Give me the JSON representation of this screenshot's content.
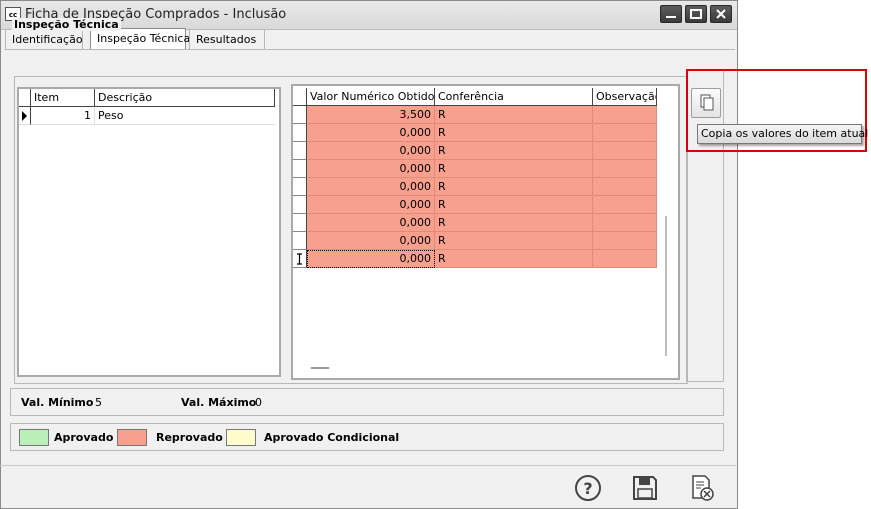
{
  "window": {
    "title": "Ficha de Inspeção Comprados - Inclusão",
    "app_icon_text": "cc"
  },
  "tabs": [
    {
      "label": "Identificação",
      "active": false
    },
    {
      "label": "Inspeção Técnica",
      "active": true
    },
    {
      "label": "Resultados",
      "active": false
    }
  ],
  "group": {
    "title": "Inspeção Técnica"
  },
  "items_grid": {
    "columns": [
      "Item",
      "Descrição"
    ],
    "rows": [
      {
        "item": "1",
        "descricao": "Peso"
      }
    ]
  },
  "values_grid": {
    "columns": [
      "Valor Numérico Obtido",
      "Conferência",
      "Observação"
    ],
    "rows": [
      {
        "valor": "3,500",
        "conferencia": "R",
        "observacao": ""
      },
      {
        "valor": "0,000",
        "conferencia": "R",
        "observacao": ""
      },
      {
        "valor": "0,000",
        "conferencia": "R",
        "observacao": ""
      },
      {
        "valor": "0,000",
        "conferencia": "R",
        "observacao": ""
      },
      {
        "valor": "0,000",
        "conferencia": "R",
        "observacao": ""
      },
      {
        "valor": "0,000",
        "conferencia": "R",
        "observacao": ""
      },
      {
        "valor": "0,000",
        "conferencia": "R",
        "observacao": ""
      },
      {
        "valor": "0,000",
        "conferencia": "R",
        "observacao": ""
      },
      {
        "valor": "0,000",
        "conferencia": "R",
        "observacao": ""
      }
    ],
    "row_color": "#f7a08d"
  },
  "copy_button": {
    "tooltip": "Copia os valores do item atual",
    "icon": "copy-icon"
  },
  "limits": {
    "min_label": "Val. Mínimo",
    "min_value": "5",
    "max_label": "Val. Máximo",
    "max_value": "0"
  },
  "legend": [
    {
      "label": "Aprovado",
      "color": "#b8f0b8"
    },
    {
      "label": "Reprovado",
      "color": "#f7a08d"
    },
    {
      "label": "Aprovado Condicional",
      "color": "#fffccc"
    }
  ],
  "footer_buttons": [
    "help-icon",
    "save-icon",
    "cancel-document-icon"
  ],
  "colors": {
    "highlight_border": "#e00000"
  }
}
